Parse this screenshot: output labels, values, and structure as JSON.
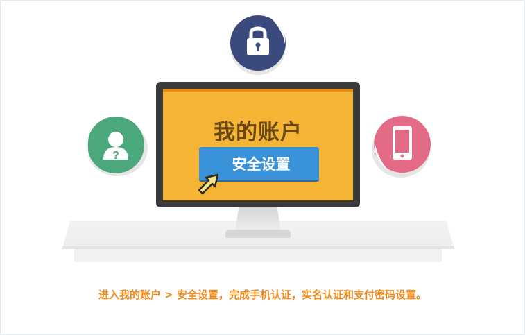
{
  "screen": {
    "title": "我的账户",
    "security_button_label": "安全设置"
  },
  "caption": "进入我的账户 > 安全设置，完成手机认证，实名认证和支付密码设置。",
  "icons": {
    "lock": "lock-icon",
    "user_question": "user-question-icon",
    "phone": "phone-icon",
    "cursor": "cursor-arrow-icon"
  },
  "colors": {
    "lock_circle": "#3b4a7c",
    "user_circle": "#4ba77c",
    "phone_circle": "#e46b86",
    "screen_bg": "#f5b434",
    "button_bg": "#3a93d8",
    "caption_text": "#f08a1d"
  }
}
